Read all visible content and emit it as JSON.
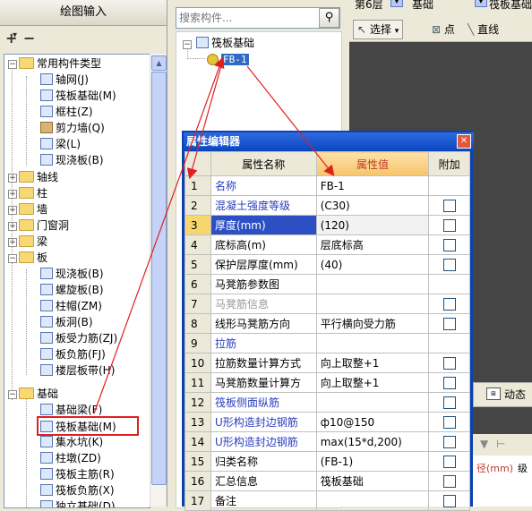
{
  "left_panel": {
    "title": "绘图输入",
    "add_symbol": "+",
    "remove_symbol": "−",
    "tree": {
      "root": {
        "label": "常用构件类型",
        "children": [
          "轴网(J)",
          "筏板基础(M)",
          "框柱(Z)",
          "剪力墙(Q)",
          "梁(L)",
          "现浇板(B)"
        ]
      },
      "groups": [
        "轴线",
        "柱",
        "墙",
        "门窗洞",
        "梁"
      ],
      "board": {
        "label": "板",
        "children": [
          "现浇板(B)",
          "螺旋板(B)",
          "柱帽(ZM)",
          "板洞(B)",
          "板受力筋(ZJ)",
          "板负筋(FJ)",
          "楼层板带(H)"
        ]
      },
      "foundation": {
        "label": "基础",
        "children": [
          "基础梁(F)",
          "筏板基础(M)",
          "集水坑(K)",
          "柱墩(ZD)",
          "筏板主筋(R)",
          "筏板负筋(X)",
          "独立基础(D)"
        ]
      }
    }
  },
  "search": {
    "placeholder": "搜索构件..."
  },
  "middle_tree": {
    "root": "筏板基础",
    "item": "FB-1"
  },
  "toolbar": {
    "floor": "第6层",
    "category": "基础",
    "component": "筏板基础",
    "select_label": "选择",
    "point_label": "点",
    "line_label": "直线"
  },
  "right_fragments": {
    "dynamic": "动态",
    "unit": "径(mm)",
    "level": "级"
  },
  "dialog": {
    "title": "属性编辑器",
    "headers": {
      "name": "属性名称",
      "value": "属性值",
      "add": "附加"
    },
    "rows": [
      {
        "n": "1",
        "name": "名称",
        "value": "FB-1",
        "blue": true,
        "check": false
      },
      {
        "n": "2",
        "name": "混凝土强度等级",
        "value": "(C30)",
        "blue": true,
        "check": true
      },
      {
        "n": "3",
        "name": "厚度(mm)",
        "value": "(120)",
        "blue": true,
        "check": true,
        "selected": true
      },
      {
        "n": "4",
        "name": "底标高(m)",
        "value": "层底标高",
        "blue": false,
        "check": true
      },
      {
        "n": "5",
        "name": "保护层厚度(mm)",
        "value": "(40)",
        "blue": false,
        "check": true
      },
      {
        "n": "6",
        "name": "马凳筋参数图",
        "value": "",
        "blue": false,
        "check": false
      },
      {
        "n": "7",
        "name": "马凳筋信息",
        "value": "",
        "blue": false,
        "gray": true,
        "check": true
      },
      {
        "n": "8",
        "name": "线形马凳筋方向",
        "value": "平行横向受力筋",
        "blue": false,
        "check": true
      },
      {
        "n": "9",
        "name": "拉筋",
        "value": "",
        "blue": true,
        "check": false
      },
      {
        "n": "10",
        "name": "拉筋数量计算方式",
        "value": "向上取整+1",
        "blue": false,
        "check": true
      },
      {
        "n": "11",
        "name": "马凳筋数量计算方",
        "value": "向上取整+1",
        "blue": false,
        "check": true
      },
      {
        "n": "12",
        "name": "筏板侧面纵筋",
        "value": "",
        "blue": true,
        "check": true
      },
      {
        "n": "13",
        "name": "U形构造封边钢筋",
        "value": "ф10@150",
        "blue": true,
        "check": true
      },
      {
        "n": "14",
        "name": "U形构造封边钢筋",
        "value": "max(15*d,200)",
        "blue": true,
        "check": true
      },
      {
        "n": "15",
        "name": "归类名称",
        "value": "(FB-1)",
        "blue": false,
        "check": true
      },
      {
        "n": "16",
        "name": "汇总信息",
        "value": "筏板基础",
        "blue": false,
        "check": true
      },
      {
        "n": "17",
        "name": "备注",
        "value": "",
        "blue": false,
        "check": true
      }
    ]
  },
  "colors": {
    "annotation": "#e02020",
    "selection": "#2c4fc4",
    "titlebar": "#0a42b0"
  }
}
